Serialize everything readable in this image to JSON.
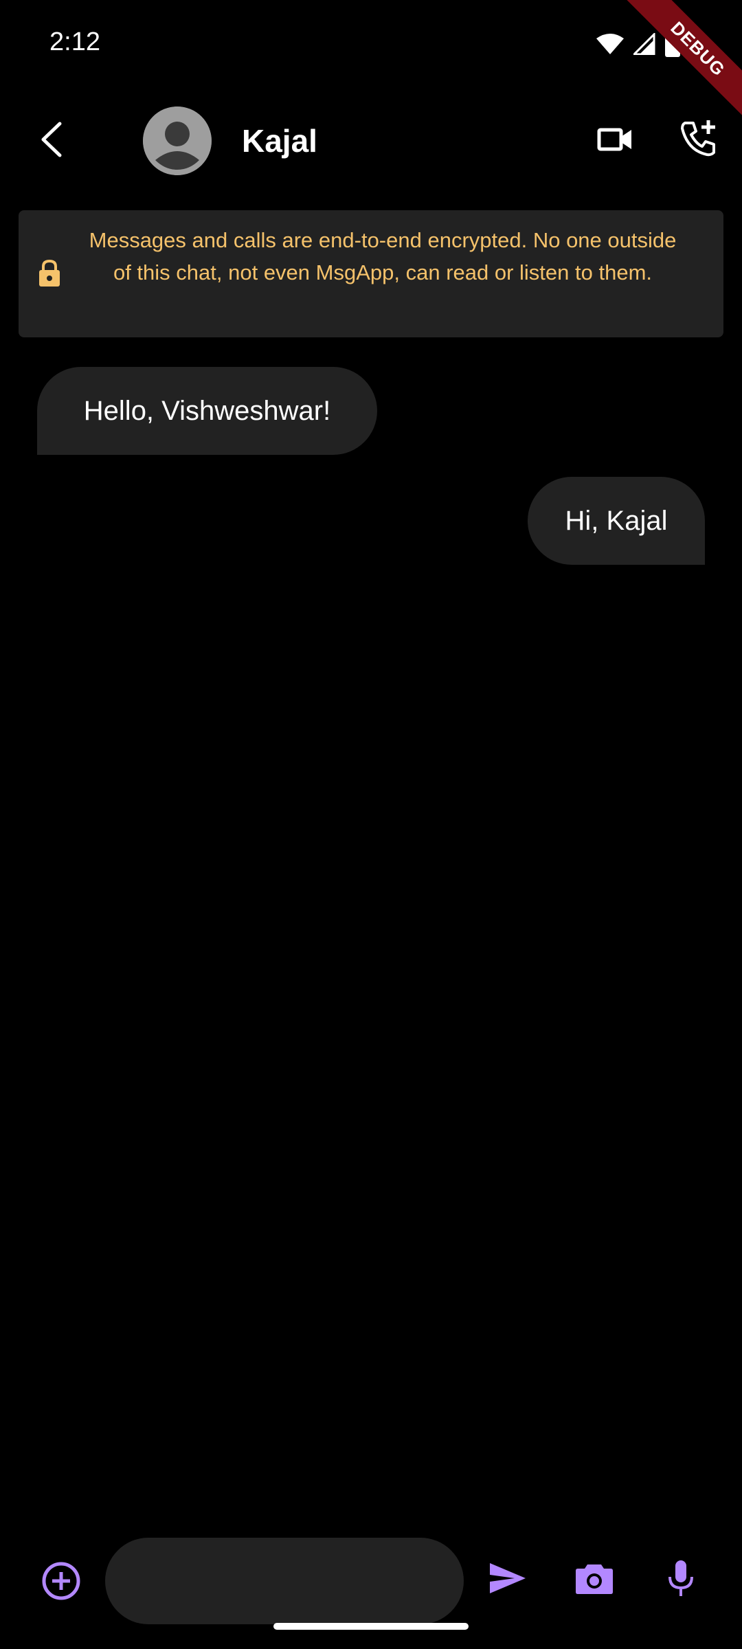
{
  "status_bar": {
    "time": "2:12",
    "icons": [
      "wifi-icon",
      "cell-signal-icon",
      "battery-icon"
    ]
  },
  "debug_banner": {
    "label": "DEBUG",
    "color": "#7a0c14"
  },
  "header": {
    "contact_name": "Kajal",
    "icons": [
      "back-icon",
      "avatar-icon",
      "video-call-icon",
      "add-call-icon"
    ]
  },
  "encryption_notice": {
    "text": "Messages and calls are end-to-end encrypted. No one outside of this chat, not even MsgApp, can read or listen to them.",
    "icon": "lock-icon",
    "text_color": "#f5c26b"
  },
  "messages": [
    {
      "direction": "incoming",
      "text": "Hello, Vishweshwar!"
    },
    {
      "direction": "outgoing",
      "text": "Hi, Kajal"
    }
  ],
  "composer": {
    "input_value": "",
    "input_placeholder": "",
    "icons": [
      "add-circle-icon",
      "send-icon",
      "camera-icon",
      "mic-icon"
    ],
    "accent_color": "#b388ff"
  },
  "colors": {
    "background": "#000000",
    "surface": "#222222",
    "text": "#ffffff"
  }
}
